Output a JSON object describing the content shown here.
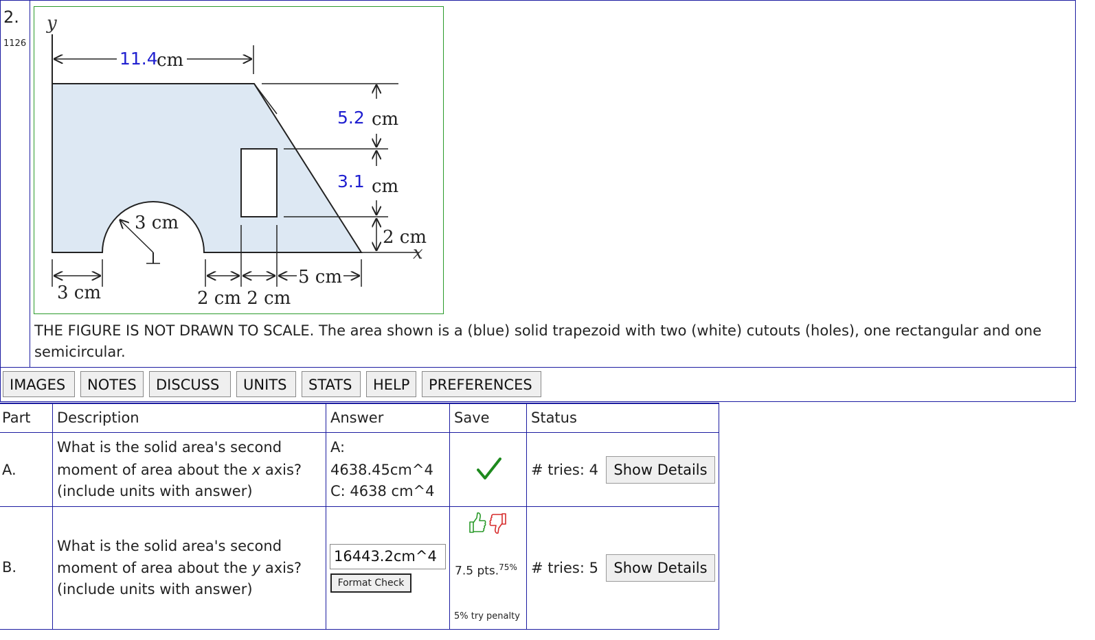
{
  "question": {
    "number": "2.",
    "id": "1126",
    "description": "THE FIGURE IS NOT DRAWN TO SCALE. The area shown is a (blue) solid trapezoid with two (white) cutouts (holes), one rectangular and one semicircular."
  },
  "figure": {
    "axis_y": "y",
    "axis_x": "x",
    "dim_top_value": "11.4",
    "dim_top_unit": "cm",
    "dim_52_value": "5.2",
    "dim_52_unit": "cm",
    "dim_31_value": "3.1",
    "dim_31_unit": "cm",
    "dim_2cm": "2 cm",
    "dim_radius": "3 cm",
    "dim_left": "3 cm",
    "dim_bottom_2cm_2cm": "2 cm 2 cm",
    "dim_5cm": "5 cm",
    "colors": {
      "fill": "#dde8f3",
      "blue_value": "#1f1fd0",
      "frame": "#2a9a2a"
    }
  },
  "toolbar": {
    "buttons": [
      "IMAGES",
      "NOTES",
      "DISCUSS",
      "UNITS",
      "STATS",
      "HELP",
      "PREFERENCES"
    ]
  },
  "table": {
    "headers": {
      "part": "Part",
      "description": "Description",
      "answer": "Answer",
      "save": "Save",
      "status": "Status"
    },
    "rows": [
      {
        "part": "A.",
        "desc_line1": "What is the solid area's second",
        "desc_line2_pre": "moment of area about the ",
        "desc_axis": "x",
        "desc_line2_post": " axis?",
        "desc_line3": "(include units with answer)",
        "answer_line1": "A:",
        "answer_line2": "4638.45cm^4",
        "answer_line3": "C: 4638 cm^4",
        "save_icon": "check-icon",
        "tries": "# tries: 4",
        "details": "Show Details"
      },
      {
        "part": "B.",
        "desc_line1": "What is the solid area's second",
        "desc_line2_pre": "moment of area about the ",
        "desc_axis": "y",
        "desc_line2_post": " axis?",
        "desc_line3": "(include units with answer)",
        "input_value": "16443.2cm^4",
        "format_check": "Format Check",
        "pts": "7.5 pts.",
        "pct": "75%",
        "penalty": "5% try penalty",
        "tries": "# tries: 5",
        "details": "Show Details"
      }
    ]
  }
}
